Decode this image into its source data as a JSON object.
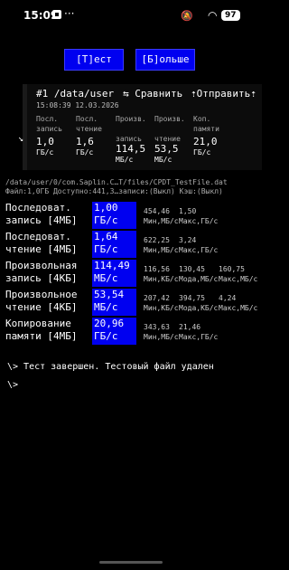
{
  "status": {
    "time": "15:09",
    "more": "···",
    "battery": "97"
  },
  "buttons": {
    "test": "[Т]ест",
    "more": "[Б]ольше"
  },
  "header": {
    "title": "#1 /data/user",
    "compare": "⇆ Сравнить",
    "send": "⇡Отправить⇡",
    "datetime": "15:08:39 12.03.2026",
    "cols": [
      {
        "h1": "Посл.",
        "h2": "запись",
        "value": "1,0",
        "unit": "ГБ/с"
      },
      {
        "h1": "Посл.",
        "h2": "чтение",
        "value": "1,6",
        "unit": "ГБ/с"
      },
      {
        "h1": "Произв.",
        "h2": "запись",
        "value": "114,5",
        "unit": "МБ/с"
      },
      {
        "h1": "Произв.",
        "h2": "чтение",
        "value": "53,5",
        "unit": "МБ/с"
      },
      {
        "h1": "Коп.",
        "h2": "памяти",
        "value": "21,0",
        "unit": "ГБ/с"
      }
    ]
  },
  "file": {
    "path": "/data/user/0/com.Saplin.C…T/files/CPDT_TestFile.dat",
    "info": "Файл:1,0ГБ Доступно:441,3…записи:(Выкл) Кэш:(Выкл)"
  },
  "results": [
    {
      "l1": "Последоват.",
      "l2": "запись [4МБ]",
      "v1": "1,00",
      "v2": "ГБ/с",
      "s": [
        [
          "454,46",
          "Мин,МБ/с"
        ],
        [
          "1,50",
          "Макс,ГБ/с"
        ]
      ]
    },
    {
      "l1": "Последоват.",
      "l2": "чтение [4МБ]",
      "v1": "1,64",
      "v2": "ГБ/с",
      "s": [
        [
          "622,25",
          "Мин,МБ/с"
        ],
        [
          "3,24",
          "Макс,ГБ/с"
        ]
      ]
    },
    {
      "l1": "Произвольная",
      "l2": "запись [4КБ]",
      "v1": "114,49",
      "v2": "МБ/с",
      "s": [
        [
          "116,56",
          "Мин,КБ/с"
        ],
        [
          "130,45",
          "Мода,МБ/с"
        ],
        [
          "160,75",
          "Макс,МБ/с"
        ]
      ]
    },
    {
      "l1": "Произвольное",
      "l2": "чтение [4КБ]",
      "v1": "53,54",
      "v2": "МБ/с",
      "s": [
        [
          "207,42",
          "Мин,КБ/с"
        ],
        [
          "394,75",
          "Мода,КБ/с"
        ],
        [
          "4,24",
          "Макс,МБ/с"
        ]
      ]
    },
    {
      "l1": "Копирование",
      "l2": "памяти [4МБ]",
      "v1": "20,96",
      "v2": "ГБ/с",
      "s": [
        [
          "343,63",
          "Мин,МБ/с"
        ],
        [
          "21,46",
          "Макс,ГБ/с"
        ]
      ]
    }
  ],
  "console": {
    "line1": "\\> Тест завершен. Тестовый файл удален",
    "line2": "\\>"
  }
}
